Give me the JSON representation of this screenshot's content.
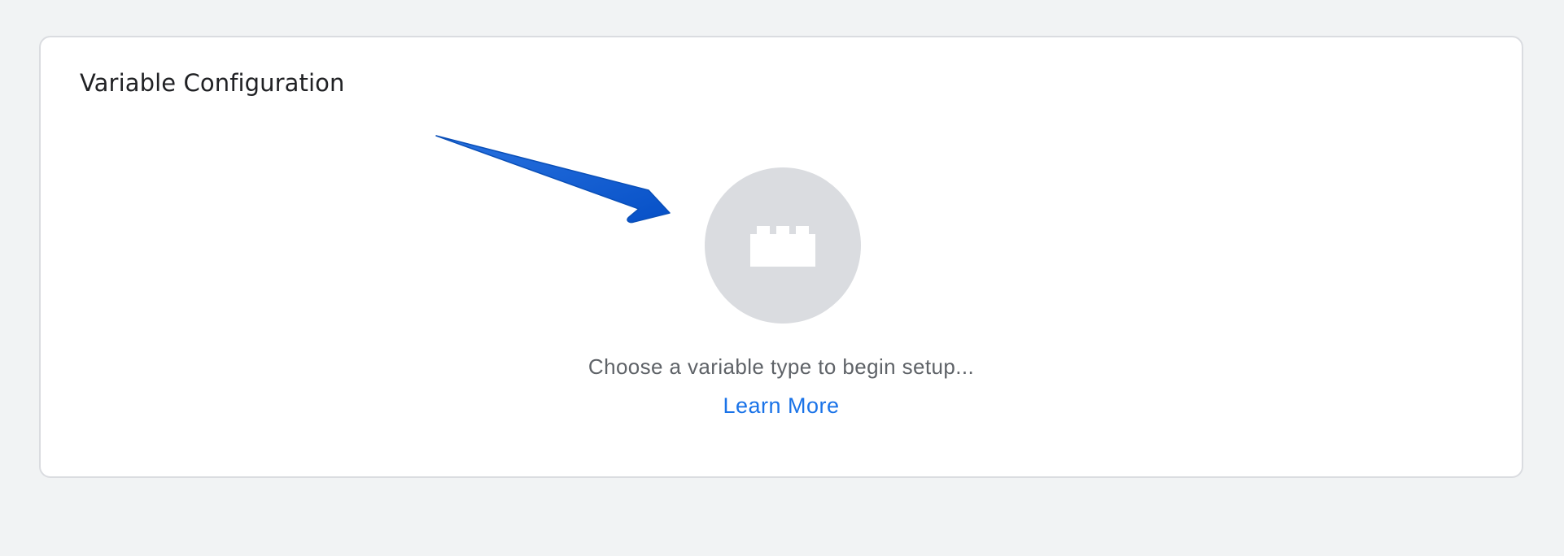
{
  "panel": {
    "title": "Variable Configuration",
    "empty_state": {
      "icon": "lego-brick-icon",
      "prompt": "Choose a variable type to begin setup...",
      "learn_more_label": "Learn More"
    },
    "annotation": {
      "icon": "arrow-icon",
      "color": "#0b5fd6"
    }
  },
  "colors": {
    "page_background": "#f1f3f4",
    "card_background": "#ffffff",
    "card_border": "#dadce0",
    "circle": "#dadce0",
    "title_text": "#202124",
    "prompt_text": "#5f6368",
    "link": "#1a73e8"
  }
}
